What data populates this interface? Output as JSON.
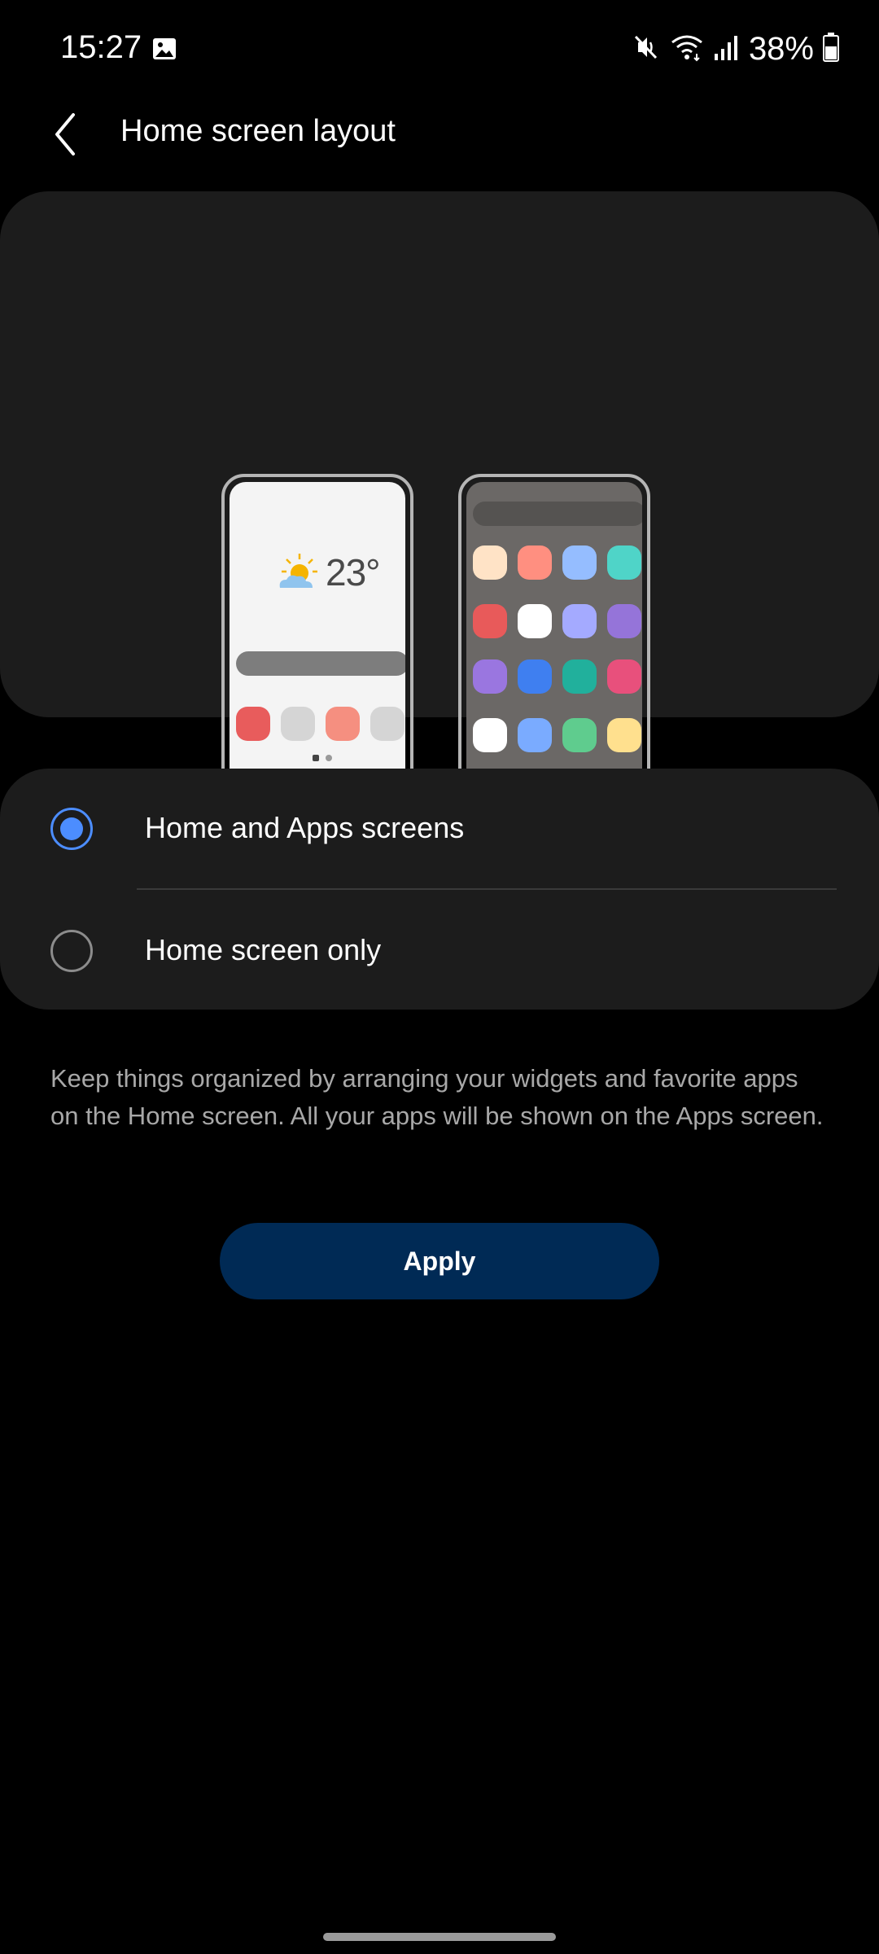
{
  "status_bar": {
    "time": "15:27",
    "battery": "38%",
    "icons": [
      "gallery-icon",
      "mute-icon",
      "wifi-icon",
      "signal-icon",
      "battery-icon"
    ]
  },
  "header": {
    "title": "Home screen layout",
    "back_icon": "chevron-left-icon"
  },
  "preview": {
    "temperature": "23°",
    "weather_icon": "partly-sunny-icon",
    "home_colors": [
      "#e85c5c",
      "#d5d5d5",
      "#f58f80",
      "#d5d5d5",
      "#24b98a",
      "#6aa8ff",
      "#8a6ff5",
      "#dc3b5e"
    ],
    "apps_colors": [
      "#ffe3c6",
      "#ff8f80",
      "#95bdff",
      "#4fd4c8",
      "#e85a5a",
      "#ffffff",
      "#a4aaff",
      "#9574d9",
      "#9a76e0",
      "#3f7ff0",
      "#21b09c",
      "#e8507c",
      "#ffffff",
      "#7aabff",
      "#5fcc8e",
      "#ffe08e",
      "#ff8a80",
      "#f07ac8"
    ]
  },
  "options": [
    {
      "label": "Home and Apps screens",
      "selected": true
    },
    {
      "label": "Home screen only",
      "selected": false
    }
  ],
  "description": "Keep things organized by arranging your widgets and favorite apps on the Home screen. All your apps will be shown on the Apps screen.",
  "apply_label": "Apply",
  "colors": {
    "accent": "#4c8dff",
    "apply_bg": "#002a55",
    "card_bg": "#1c1c1c"
  }
}
